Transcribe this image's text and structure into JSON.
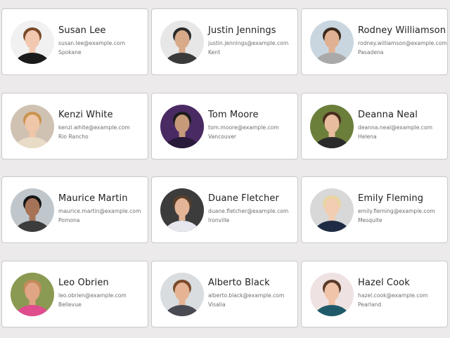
{
  "contacts": [
    {
      "name": "Susan Lee",
      "email": "susan.lee@example.com",
      "city": "Spokane",
      "photo": {
        "bg": "#f1f1f1",
        "skin": "#f2c9b0",
        "hair": "#7a4a2a",
        "shirt": "#1b1b1b"
      }
    },
    {
      "name": "Justin Jennings",
      "email": "justin.jennings@example.com",
      "city": "Kent",
      "photo": {
        "bg": "#e7e7e7",
        "skin": "#d8aa8a",
        "hair": "#2a2a2a",
        "shirt": "#3a3a3a"
      }
    },
    {
      "name": "Rodney Williamson",
      "email": "rodney.williamson@example.com",
      "city": "Pasadena",
      "photo": {
        "bg": "#c9d6df",
        "skin": "#e0b192",
        "hair": "#3b2a1d",
        "shirt": "#a9a9a9"
      }
    },
    {
      "name": "Kenzi White",
      "email": "kenzi.white@example.com",
      "city": "Rio Rancho",
      "photo": {
        "bg": "#cfc2b3",
        "skin": "#f0c6a8",
        "hair": "#c9944d",
        "shirt": "#e9dcc7"
      }
    },
    {
      "name": "Tom Moore",
      "email": "tom.moore@example.com",
      "city": "Vancouver",
      "photo": {
        "bg": "#4a2a63",
        "skin": "#c79a7b",
        "hair": "#1c1c1c",
        "shirt": "#2a1a3a"
      }
    },
    {
      "name": "Deanna Neal",
      "email": "deanna.neal@example.com",
      "city": "Helena",
      "photo": {
        "bg": "#6b7f3a",
        "skin": "#e8bd9e",
        "hair": "#4a2e1c",
        "shirt": "#2b2b2b"
      }
    },
    {
      "name": "Maurice Martin",
      "email": "maurice.martin@example.com",
      "city": "Pomona",
      "photo": {
        "bg": "#bfc7cc",
        "skin": "#a77358",
        "hair": "#161616",
        "shirt": "#3c3c3c"
      }
    },
    {
      "name": "Duane Fletcher",
      "email": "duane.fletcher@example.com",
      "city": "Ironville",
      "photo": {
        "bg": "#3c3c3c",
        "skin": "#e3b596",
        "hair": "#5a3e2a",
        "shirt": "#e6e6ee"
      }
    },
    {
      "name": "Emily Fleming",
      "email": "emily.fleming@example.com",
      "city": "Mesquite",
      "photo": {
        "bg": "#d8d8d8",
        "skin": "#f2cdb2",
        "hair": "#e8d6a2",
        "shirt": "#1f2a44"
      }
    },
    {
      "name": "Leo Obrien",
      "email": "leo.obrien@example.com",
      "city": "Bellevue",
      "photo": {
        "bg": "#8a9a52",
        "skin": "#e0a585",
        "hair": "#c28a5a",
        "shirt": "#e04d8f"
      }
    },
    {
      "name": "Alberto Black",
      "email": "alberto.black@example.com",
      "city": "Visalia",
      "photo": {
        "bg": "#d9dde0",
        "skin": "#e6b394",
        "hair": "#7b4a2a",
        "shirt": "#4a4a52"
      }
    },
    {
      "name": "Hazel Cook",
      "email": "hazel.cook@example.com",
      "city": "Pearland",
      "photo": {
        "bg": "#efe2e2",
        "skin": "#efc4a8",
        "hair": "#5a3a28",
        "shirt": "#1f5a6a"
      }
    }
  ]
}
